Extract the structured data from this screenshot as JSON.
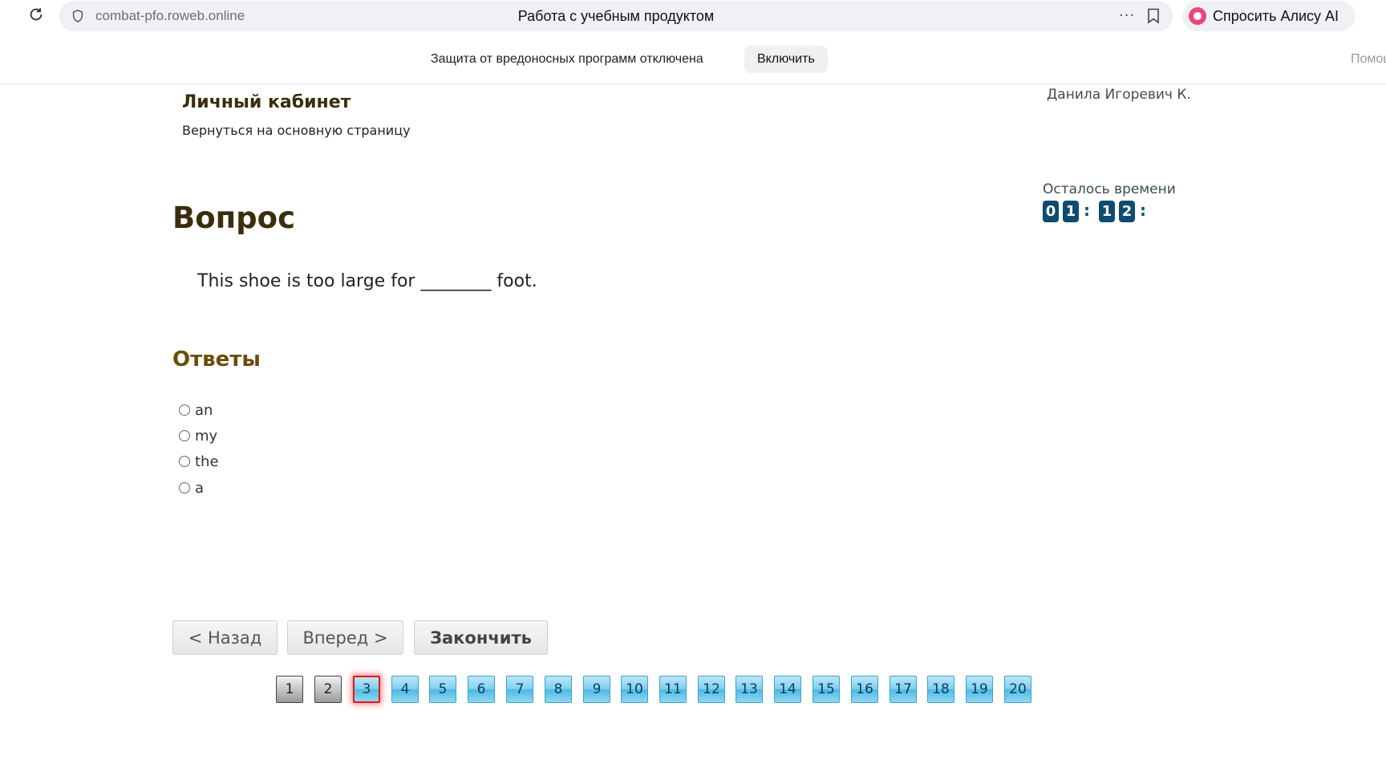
{
  "browser": {
    "url": "combat-pfo.roweb.online",
    "tab_title": "Работа с учебным продуктом",
    "more_glyph": "···",
    "alice_label": "Спросить Алису AI"
  },
  "notice": {
    "text": "Защита от вредоносных программ отключена",
    "enable_label": "Включить",
    "help_label": "Помощь"
  },
  "header": {
    "title": "Личный кабинет",
    "back_link": "Вернуться на основную страницу",
    "user_name": "Данила Игоревич К."
  },
  "timer": {
    "label": "Осталось времени",
    "digits": [
      "0",
      "1",
      "1",
      "2"
    ],
    "separator": ":"
  },
  "question": {
    "heading": "Вопрос",
    "text": "This shoe is too large for ________ foot."
  },
  "answers": {
    "heading": "Ответы",
    "options": [
      "an",
      "my",
      "the",
      "a"
    ]
  },
  "nav": {
    "back": "< Назад",
    "forward": "Вперед >",
    "finish": "Закончить"
  },
  "pagination": {
    "pages": [
      "1",
      "2",
      "3",
      "4",
      "5",
      "6",
      "7",
      "8",
      "9",
      "10",
      "11",
      "12",
      "13",
      "14",
      "15",
      "16",
      "17",
      "18",
      "19",
      "20"
    ],
    "answered": [
      1,
      2
    ],
    "current": 3
  },
  "colors": {
    "timer_digit_bg": "#0e4c6f",
    "current_page_border": "#e01818",
    "page_box_blue": "#7fd0ef",
    "heading_brown": "#3b2e0c"
  }
}
